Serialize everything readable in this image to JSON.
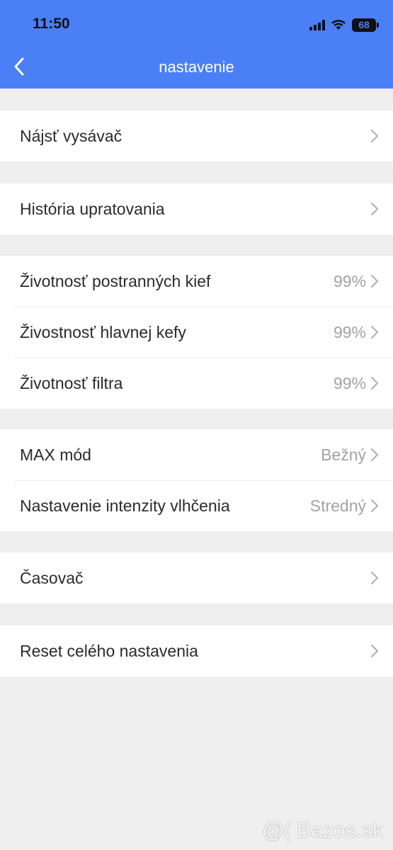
{
  "status_bar": {
    "time": "11:50",
    "battery": "68"
  },
  "header": {
    "title": "nastavenie"
  },
  "groups": [
    {
      "rows": [
        {
          "label": "Nájsť vysávač",
          "value": ""
        }
      ]
    },
    {
      "rows": [
        {
          "label": "História upratovania",
          "value": ""
        }
      ]
    },
    {
      "rows": [
        {
          "label": "Životnosť postranných kief",
          "value": "99%"
        },
        {
          "label": "Živostnosť hlavnej kefy",
          "value": "99%"
        },
        {
          "label": "Životnosť filtra",
          "value": "99%"
        }
      ]
    },
    {
      "rows": [
        {
          "label": "MAX mód",
          "value": "Bežný"
        },
        {
          "label": "Nastavenie intenzity vlhčenia",
          "value": "Stredný"
        }
      ]
    },
    {
      "rows": [
        {
          "label": "Časovač",
          "value": ""
        }
      ]
    },
    {
      "rows": [
        {
          "label": "Reset celého nastavenia",
          "value": ""
        }
      ]
    }
  ],
  "watermark": "@( Bazos.sk",
  "colors": {
    "header": "#4a7ff5",
    "background": "#efefef"
  }
}
